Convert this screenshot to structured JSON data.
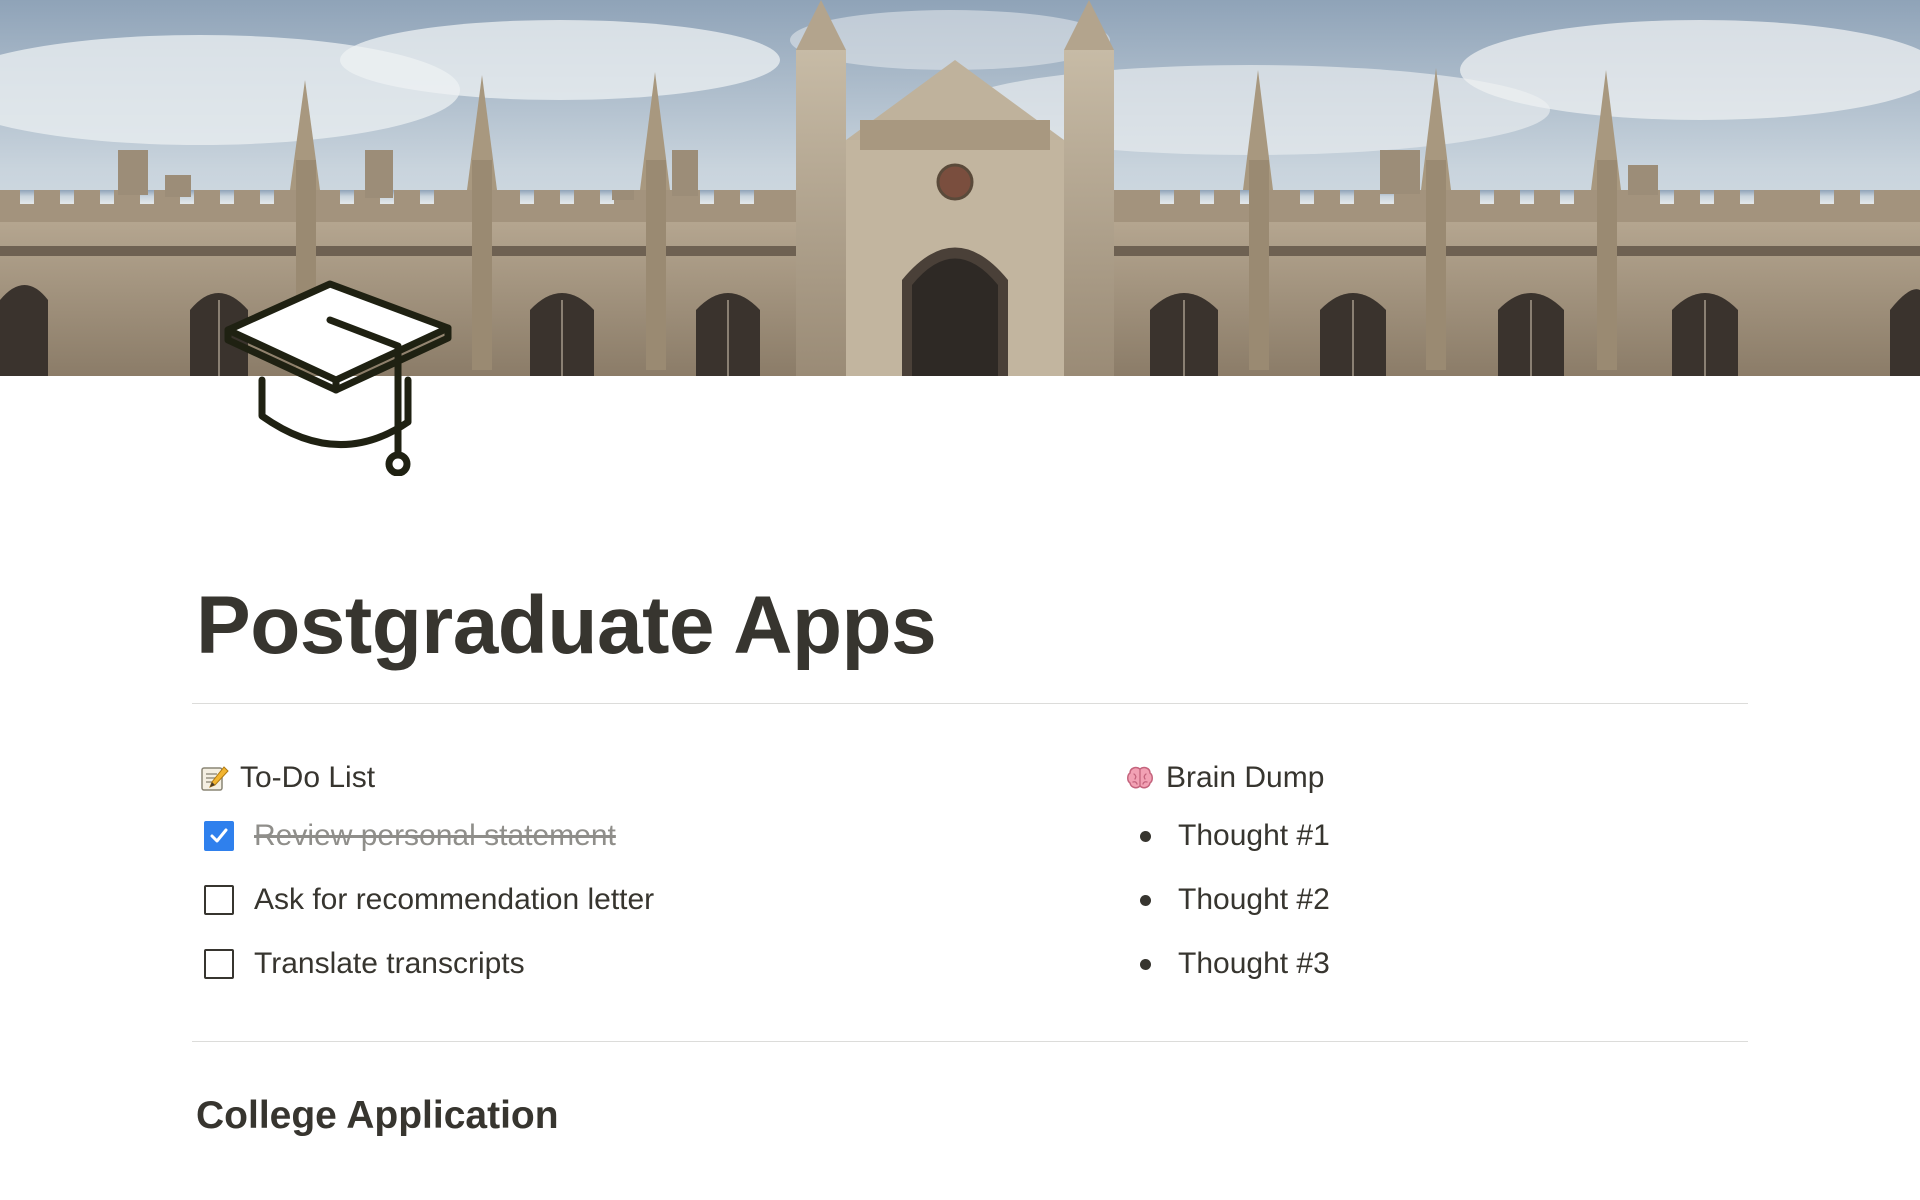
{
  "page": {
    "title": "Postgraduate Apps",
    "icon": "graduation-cap-icon",
    "cover": "university-building-cover"
  },
  "todo": {
    "heading": "To-Do List",
    "heading_icon": "memo-pencil-icon",
    "items": [
      {
        "label": "Review personal statement",
        "checked": true
      },
      {
        "label": "Ask for recommendation letter",
        "checked": false
      },
      {
        "label": "Translate transcripts",
        "checked": false
      }
    ]
  },
  "brain_dump": {
    "heading": "Brain Dump",
    "heading_icon": "brain-icon",
    "items": [
      "Thought #1",
      "Thought #2",
      "Thought #3"
    ]
  },
  "sections": {
    "college_application": "College Application"
  },
  "colors": {
    "text": "#37352f",
    "checkbox_checked": "#2f80ed",
    "muted_text": "#8f8e8a",
    "divider": "#dcdcda"
  }
}
